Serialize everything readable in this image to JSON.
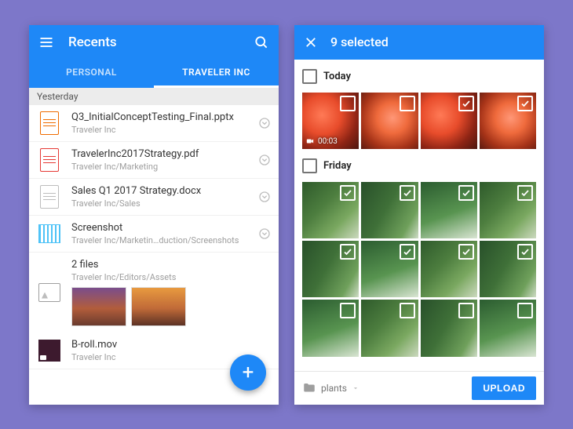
{
  "left": {
    "header": {
      "title": "Recents"
    },
    "tabs": [
      {
        "label": "PERSONAL",
        "active": false
      },
      {
        "label": "TRAVELER INC",
        "active": true
      }
    ],
    "section": "Yesterday",
    "items": [
      {
        "icon": "pptx-icon",
        "name": "Q3_InitialConceptTesting_Final.pptx",
        "sub": "Traveler Inc"
      },
      {
        "icon": "pdf-icon",
        "name": "TravelerInc2017Strategy.pdf",
        "sub": "Traveler Inc/Marketing"
      },
      {
        "icon": "docx-icon",
        "name": "Sales Q1 2017 Strategy.docx",
        "sub": "Traveler Inc/Sales"
      },
      {
        "icon": "screenshot-icon",
        "name": "Screenshot",
        "sub": "Traveler Inc/Marketin…duction/Screenshots"
      },
      {
        "icon": "images-icon",
        "name": "2 files",
        "sub": "Traveler Inc/Editors/Assets",
        "thumbs": 2
      },
      {
        "icon": "video-icon",
        "name": "B-roll.mov",
        "sub": "Traveler Inc"
      }
    ]
  },
  "right": {
    "header": {
      "title": "9 selected"
    },
    "sections": [
      {
        "label": "Today",
        "group_checked": false,
        "tiles": [
          {
            "kind": "rose",
            "selected": false,
            "video": true,
            "duration": "00:03"
          },
          {
            "kind": "rose2",
            "selected": false
          },
          {
            "kind": "rose",
            "selected": true
          },
          {
            "kind": "rose2",
            "selected": true
          }
        ]
      },
      {
        "label": "Friday",
        "group_checked": false,
        "tiles": [
          {
            "kind": "plant1",
            "selected": true
          },
          {
            "kind": "plant2",
            "selected": true
          },
          {
            "kind": "plant3",
            "selected": true
          },
          {
            "kind": "plant1",
            "selected": true
          },
          {
            "kind": "plant2",
            "selected": true
          },
          {
            "kind": "plant3",
            "selected": true
          },
          {
            "kind": "plant1",
            "selected": true
          },
          {
            "kind": "plant2",
            "selected": true
          },
          {
            "kind": "plant3",
            "selected": false
          },
          {
            "kind": "plant1",
            "selected": false
          },
          {
            "kind": "plant2",
            "selected": false
          },
          {
            "kind": "plant3",
            "selected": false
          }
        ]
      }
    ],
    "location": "plants",
    "upload_label": "UPLOAD"
  }
}
